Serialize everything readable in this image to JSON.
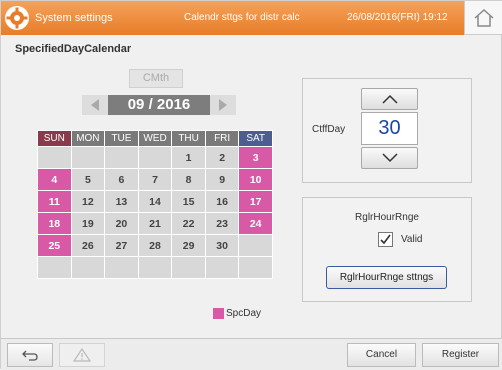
{
  "header": {
    "title": "System settings",
    "subtitle": "Calendr sttgs for distr calc",
    "datetime": "26/08/2016(FRI) 19:12"
  },
  "section_title": "SpecifiedDayCalendar",
  "calendar": {
    "cmth_label": "CMth",
    "month_label": "09 / 2016",
    "weekdays": [
      "SUN",
      "MON",
      "TUE",
      "WED",
      "THU",
      "FRI",
      "SAT"
    ],
    "weeks": [
      [
        "",
        "",
        "",
        "",
        "1",
        "2",
        "3"
      ],
      [
        "4",
        "5",
        "6",
        "7",
        "8",
        "9",
        "10"
      ],
      [
        "11",
        "12",
        "13",
        "14",
        "15",
        "16",
        "17"
      ],
      [
        "18",
        "19",
        "20",
        "21",
        "22",
        "23",
        "24"
      ],
      [
        "25",
        "26",
        "27",
        "28",
        "29",
        "30",
        ""
      ],
      [
        "",
        "",
        "",
        "",
        "",
        "",
        ""
      ]
    ],
    "specified_days": [
      "3",
      "4",
      "10",
      "11",
      "17",
      "18",
      "24",
      "25"
    ],
    "legend_label": "SpcDay",
    "special_color": "#d85aa7"
  },
  "cutoff": {
    "label": "CtffDay",
    "value": "30"
  },
  "regular_hour_range": {
    "label": "RglrHourRnge",
    "valid_label": "Valid",
    "valid_checked": true,
    "settings_button": "RglrHourRnge sttngs"
  },
  "footer": {
    "cancel_label": "Cancel",
    "register_label": "Register"
  },
  "colors": {
    "header_orange": "#e77d28",
    "accent_blue": "#1a46a8"
  }
}
